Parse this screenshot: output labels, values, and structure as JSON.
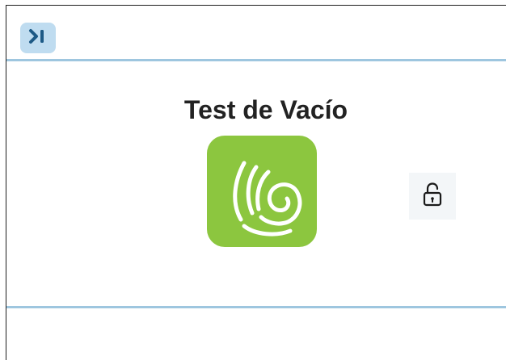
{
  "header": {
    "toggle_icon": "expand-sidebar-icon",
    "accent": "#bfdcf0"
  },
  "main": {
    "title": "Test de Vacío",
    "app_icon": "waving-hand-icon",
    "app_icon_color": "#8cc63f",
    "lock_icon": "unlocked-padlock-icon"
  },
  "divider_color": "#9ec6df"
}
